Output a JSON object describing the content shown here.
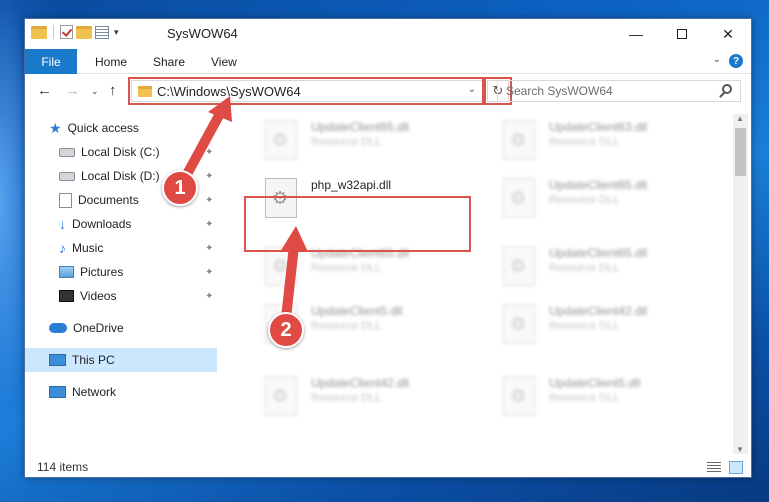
{
  "window": {
    "title": "SysWOW64",
    "min_glyph": "—",
    "close_glyph": "✕"
  },
  "ribbon": {
    "tabs": [
      {
        "label": "File"
      },
      {
        "label": "Home"
      },
      {
        "label": "Share"
      },
      {
        "label": "View"
      }
    ],
    "help_glyph": "?",
    "collapse_glyph": "⌄"
  },
  "nav": {
    "back_glyph": "←",
    "forward_glyph": "→",
    "recent_glyph": "⌄",
    "up_glyph": "↑",
    "address": "C:\\Windows\\SysWOW64",
    "address_dropdown_glyph": "⌄",
    "refresh_glyph": "↻",
    "search_placeholder": "Search SysWOW64"
  },
  "sidebar": {
    "items": [
      {
        "label": "Quick access",
        "icon": "star-icon"
      },
      {
        "label": "Local Disk (C:)",
        "icon": "disk-icon",
        "pinned": true
      },
      {
        "label": "Local Disk (D:)",
        "icon": "disk-icon",
        "pinned": true
      },
      {
        "label": "Documents",
        "icon": "documents-icon",
        "pinned": true
      },
      {
        "label": "Downloads",
        "icon": "download-icon",
        "pinned": true
      },
      {
        "label": "Music",
        "icon": "music-icon",
        "pinned": true
      },
      {
        "label": "Pictures",
        "icon": "pictures-icon",
        "pinned": true
      },
      {
        "label": "Videos",
        "icon": "videos-icon",
        "pinned": true
      },
      {
        "label": "OneDrive",
        "icon": "cloud-icon"
      },
      {
        "label": "This PC",
        "icon": "pc-icon",
        "selected": true
      },
      {
        "label": "Network",
        "icon": "network-icon"
      }
    ],
    "pin_glyph": "📌"
  },
  "files": [
    {
      "name": "UpdateClient65.dll",
      "type": "Resource DLL",
      "blurred": true
    },
    {
      "name": "UpdateClient63.dll",
      "type": "Resource DLL",
      "blurred": true
    },
    {
      "name": "php_w32api.dll",
      "type": "",
      "blurred": false,
      "highlighted": true
    },
    {
      "name": "UpdateClient65.dll",
      "type": "Resource DLL",
      "blurred": true
    },
    {
      "name": "UpdateClient65.dll",
      "type": "Resource DLL",
      "blurred": true
    },
    {
      "name": "UpdateClient65.dll",
      "type": "Resource DLL",
      "blurred": true
    },
    {
      "name": "UpdateClient5.dll",
      "type": "Resource DLL",
      "blurred": true
    },
    {
      "name": "UpdateClient42.dll",
      "type": "Resource DLL",
      "blurred": true
    },
    {
      "name": "UpdateClient42.dll",
      "type": "Resource DLL",
      "blurred": true
    },
    {
      "name": "UpdateClient5.dll",
      "type": "Resource DLL",
      "blurred": true
    }
  ],
  "status": {
    "item_count": "114 items"
  },
  "annotations": {
    "step1": "1",
    "step2": "2",
    "color": "#e04a45"
  },
  "scroll": {
    "up_glyph": "▲",
    "down_glyph": "▼"
  }
}
